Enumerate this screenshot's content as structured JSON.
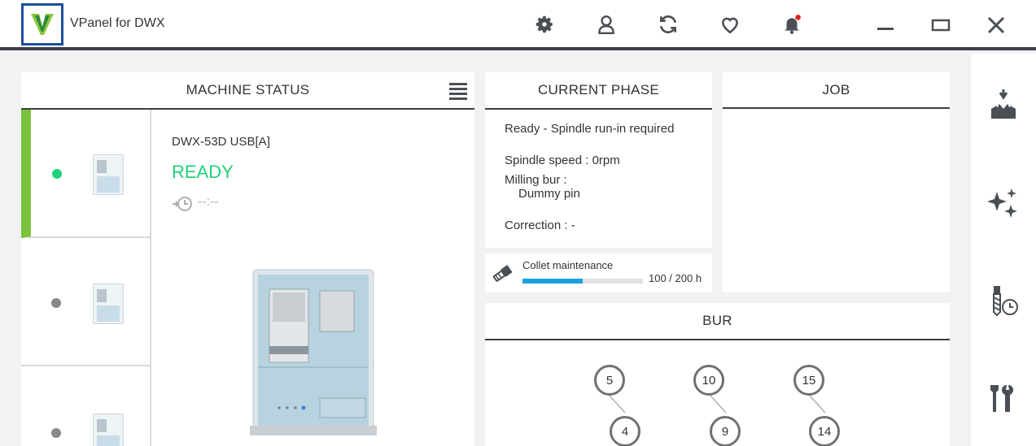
{
  "app": {
    "title": "VPanel for DWX"
  },
  "toolbar_icons": [
    "gear-icon",
    "user-icon",
    "refresh-icon",
    "heart-icon",
    "bell-icon"
  ],
  "colors": {
    "accent_green": "#7dc23b",
    "ready_green": "#21d07a",
    "progress_blue": "#1a9fe0",
    "dark_border": "#3a3f46",
    "notification_red": "#e0201e"
  },
  "machine_status": {
    "title": "MACHINE STATUS",
    "selected": {
      "name": "DWX-53D USB[A]",
      "state": "READY",
      "time": "--:--"
    }
  },
  "current_phase": {
    "title": "CURRENT PHASE",
    "status": "Ready - Spindle run-in required",
    "spindle_speed": "Spindle speed : 0rpm",
    "milling_bur_label": "Milling bur :",
    "milling_bur_value": "Dummy pin",
    "correction": "Correction : -"
  },
  "collet": {
    "label": "Collet maintenance",
    "hours": "100 / 200 h",
    "progress": 0.5
  },
  "job": {
    "title": "JOB"
  },
  "bur": {
    "title": "BUR",
    "top_row": [
      "5",
      "10",
      "15"
    ],
    "bottom_row": [
      "4",
      "9",
      "14"
    ]
  },
  "sidebar_icons": [
    "milling-icon",
    "sparkle-icon",
    "bur-timer-icon",
    "tools-icon"
  ]
}
